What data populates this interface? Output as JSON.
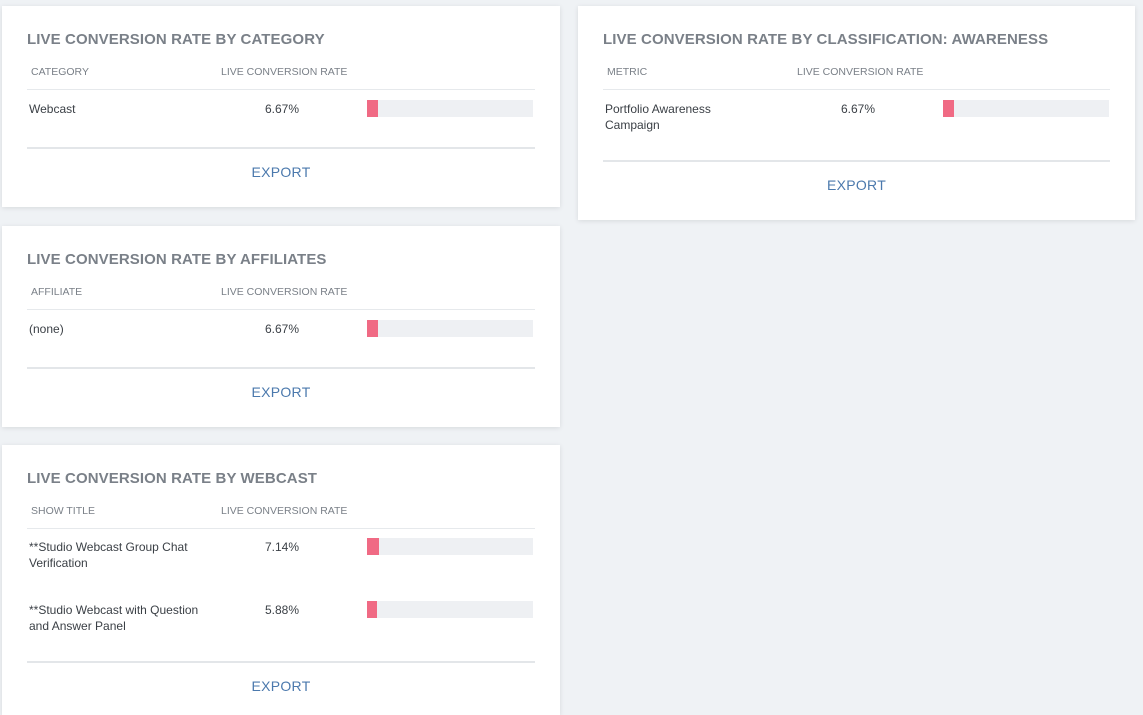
{
  "colors": {
    "bar_fill": "#f06a84",
    "bar_track": "#eef0f3",
    "export_link": "#4b79ad"
  },
  "export_label": "EXPORT",
  "cards": {
    "category": {
      "title": "LIVE CONVERSION RATE BY CATEGORY",
      "col1": "CATEGORY",
      "col2": "LIVE CONVERSION RATE",
      "rows": [
        {
          "label": "Webcast",
          "value": "6.67%",
          "rate": 6.67
        }
      ]
    },
    "classification": {
      "title": "LIVE CONVERSION RATE BY CLASSIFICATION: AWARENESS",
      "col1": "METRIC",
      "col2": "LIVE CONVERSION RATE",
      "rows": [
        {
          "label": "Portfolio Awareness Campaign",
          "value": "6.67%",
          "rate": 6.67
        }
      ]
    },
    "affiliates": {
      "title": "LIVE CONVERSION RATE BY AFFILIATES",
      "col1": "AFFILIATE",
      "col2": "LIVE CONVERSION RATE",
      "rows": [
        {
          "label": "(none)",
          "value": "6.67%",
          "rate": 6.67
        }
      ]
    },
    "webcast": {
      "title": "LIVE CONVERSION RATE BY WEBCAST",
      "col1": "SHOW TITLE",
      "col2": "LIVE CONVERSION RATE",
      "rows": [
        {
          "label": "**Studio Webcast Group Chat Verification",
          "value": "7.14%",
          "rate": 7.14
        },
        {
          "label": "**Studio Webcast with Question and Answer Panel",
          "value": "5.88%",
          "rate": 5.88
        }
      ]
    }
  }
}
